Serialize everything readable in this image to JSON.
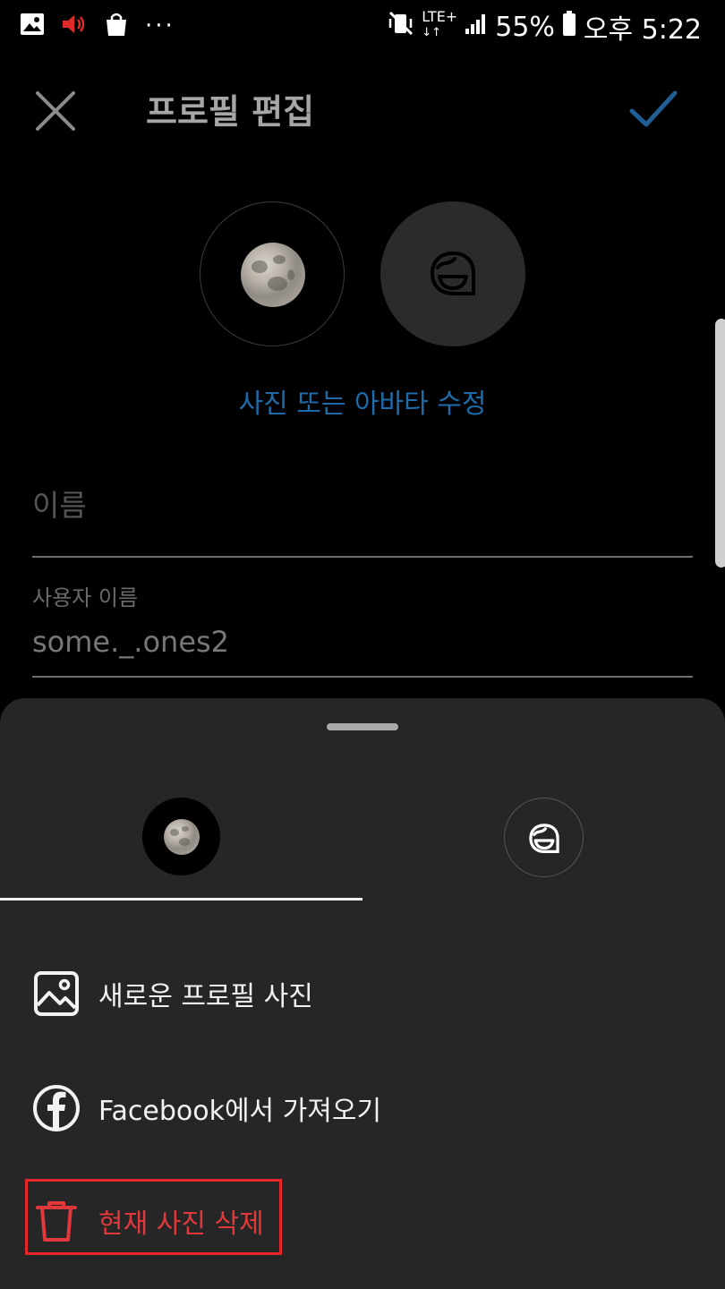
{
  "status_bar": {
    "battery": "55%",
    "time": "오후 5:22",
    "network": "LTE+"
  },
  "header": {
    "title": "프로필 편집",
    "close_icon": "close-icon",
    "confirm_icon": "check-icon"
  },
  "profile": {
    "edit_photo_label": "사진 또는 아바타 수정",
    "name_placeholder": "이름",
    "username_label": "사용자 이름",
    "username_value": "some._.ones2"
  },
  "sheet": {
    "tabs": [
      "photo-tab",
      "avatar-tab"
    ],
    "selected_tab": "photo-tab",
    "items": [
      {
        "label": "새로운 프로필 사진",
        "icon": "image-icon"
      },
      {
        "label": "Facebook에서 가져오기",
        "icon": "facebook-icon"
      },
      {
        "label": "현재 사진 삭제",
        "icon": "trash-icon"
      }
    ]
  },
  "colors": {
    "accent": "#1f6aa8",
    "destructive": "#e0383b",
    "sheet_bg": "#262626",
    "highlight_box": "#e8262a"
  }
}
